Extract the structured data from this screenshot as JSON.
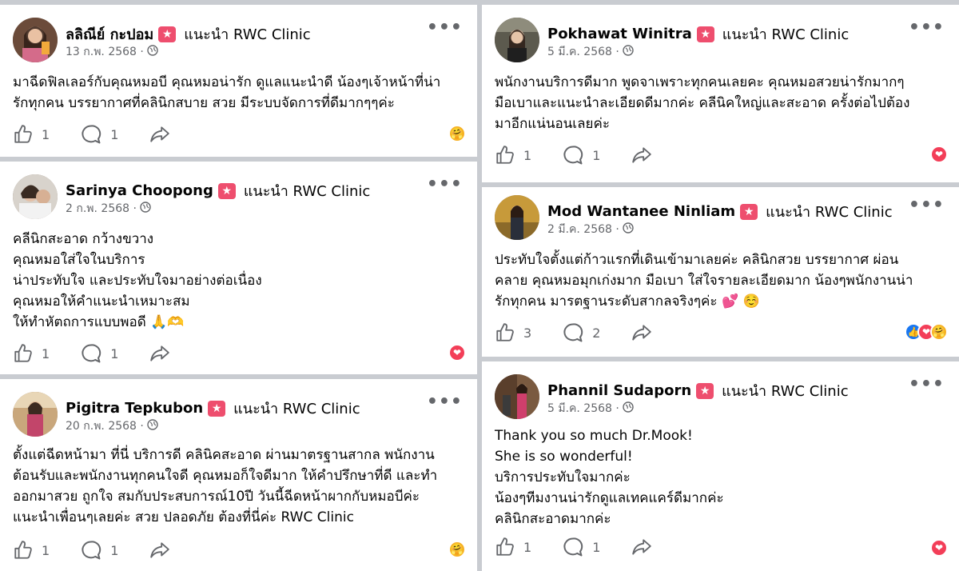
{
  "common": {
    "recommend_text": "แนะนำ RWC Clinic",
    "more_label": "•••",
    "badge_glyph": "★",
    "globe_glyph": "🌐"
  },
  "posts": [
    {
      "name": "ลลิณีย์ กะปอม",
      "date": "13 ก.พ. 2568 ·",
      "text": "มาฉีดฟิลเลอร์กับคุณหมอบี คุณหมอน่ารัก ดูแลแนะนำดี น้องๆเจ้าหน้าที่น่า\nรักทุกคน บรรยากาศที่คลินิกสบาย สวย มีระบบจัดการที่ดีมากๆๆค่ะ",
      "likes": "1",
      "comments": "1",
      "reactions": [
        "care"
      ]
    },
    {
      "name": "Sarinya Choopong",
      "date": "2 ก.พ. 2568 ·",
      "text": "คลีนิกสะอาด กว้างขวาง\nคุณหมอใส่ใจในบริการ\nน่าประทับใจ และประทับใจมาอย่างต่อเนื่อง\nคุณหมอให้คำแนะนำเหมาะสม\nให้ทำหัตถการแบบพอดี 🙏🫶",
      "likes": "1",
      "comments": "1",
      "reactions": [
        "love"
      ]
    },
    {
      "name": "Pigitra Tepkubon",
      "date": "20 ก.พ. 2568 ·",
      "text": "ตั้งแต่ฉีดหน้ามา ที่นี่ บริการดี คลินิคสะอาด ผ่านมาตรฐานสากล พนักงาน\nต้อนรับและพนักงานทุกคนใจดี คุณหมอก็ใจดีมาก ให้คำปรึกษาที่ดี และทำ\nออกมาสวย ถูกใจ สมกับประสบการณ์10ปี วันนี้ฉีดหน้าผากกับหมอบีค่ะ\nแนะนำเพื่อนๆเลยค่ะ สวย ปลอดภัย ต้องที่นี่ค่ะ RWC Clinic",
      "likes": "1",
      "comments": "1",
      "reactions": [
        "care"
      ]
    },
    {
      "name": "Pokhawat Winitra",
      "date": "5 มี.ค. 2568 ·",
      "text": "พนักงานบริการดีมาก พูดจาเพราะทุกคนเลยคะ คุณหมอสวยน่ารักมากๆ\nมือเบาและแนะนำละเอียดดีมากค่ะ คลีนิคใหญ่และสะอาด ครั้งต่อไปต้อง\nมาอีกแน่นอนเลยค่ะ",
      "likes": "1",
      "comments": "1",
      "reactions": [
        "love"
      ]
    },
    {
      "name": "Mod Wantanee Ninliam",
      "date": "2 มี.ค. 2568 ·",
      "text": "ประทับใจตั้งแต่ก้าวแรกที่เดินเข้ามาเลยค่ะ คลินิกสวย บรรยากาศ ผ่อน\nคลาย คุณหมอมุกเก่งมาก  มือเบา ใส่ใจรายละเอียดมาก น้องๆพนักงานน่า\nรักทุกคน มารตฐานระดับสากลจริงๆค่ะ 💕 ☺️",
      "likes": "3",
      "comments": "2",
      "reactions": [
        "like",
        "love",
        "care"
      ]
    },
    {
      "name": "Phannil Sudaporn",
      "date": "5 มี.ค. 2568 ·",
      "text": "Thank you so much Dr.Mook!\nShe is so wonderful!\nบริการประทับใจมากค่ะ\nน้องๆทีมงานน่ารักดูแลเทคแคร์ดีมากค่ะ\nคลินิกสะอาดมากค่ะ",
      "likes": "1",
      "comments": "1",
      "reactions": [
        "love"
      ]
    }
  ]
}
